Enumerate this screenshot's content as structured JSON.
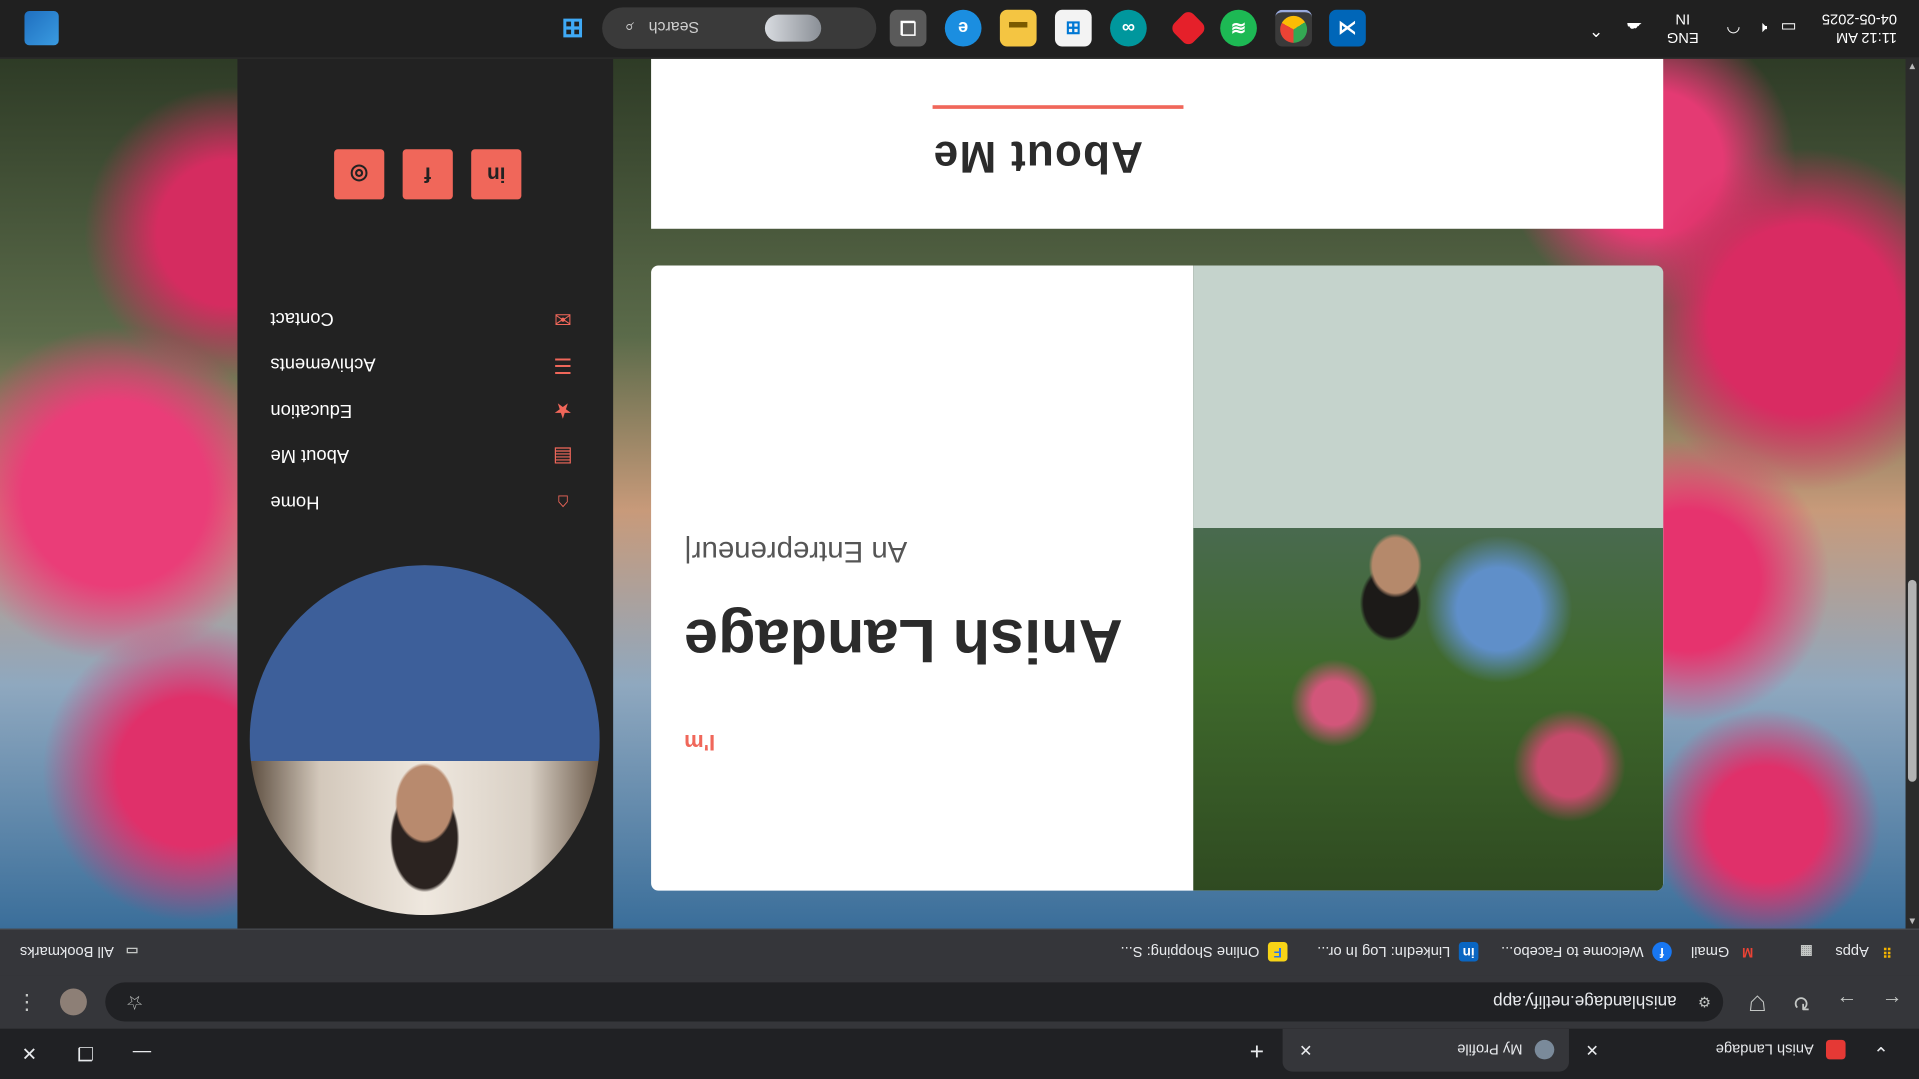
{
  "browser": {
    "tabs": [
      {
        "title": "My Profile",
        "active": true
      },
      {
        "title": "Anish Landage",
        "active": false
      }
    ],
    "new_tab": "+",
    "url": "anishlandage.netlify.app",
    "bookmarks": [
      {
        "label": "Apps",
        "icon": "apps-grid-icon"
      },
      {
        "label": "Gmail",
        "icon": "gmail-icon"
      },
      {
        "label": "Welcome to Facebo...",
        "icon": "facebook-icon"
      },
      {
        "label": "LinkedIn: Log In or...",
        "icon": "linkedin-icon"
      },
      {
        "label": "Online Shopping: S...",
        "icon": "flipkart-icon"
      }
    ],
    "all_bookmarks": "All Bookmarks"
  },
  "sidebar": {
    "nav": [
      {
        "label": "Home",
        "icon": "home-icon"
      },
      {
        "label": "About Me",
        "icon": "id-card-icon"
      },
      {
        "label": "Education",
        "icon": "graduation-icon"
      },
      {
        "label": "Achivements",
        "icon": "list-icon"
      },
      {
        "label": "Contact",
        "icon": "envelope-icon"
      }
    ],
    "socials": [
      {
        "label": "in",
        "icon": "linkedin-icon"
      },
      {
        "label": "f",
        "icon": "facebook-icon"
      },
      {
        "label": "◎",
        "icon": "instagram-icon"
      }
    ]
  },
  "hero": {
    "greeting": "I'm",
    "name": "Anish Landage",
    "role": "An Entrepreneur|"
  },
  "about": {
    "title": "About Me"
  },
  "taskbar": {
    "search_placeholder": "Search",
    "time": "11:12 AM",
    "date": "04-05-2025",
    "lang_top": "ENG",
    "lang_bottom": "IN"
  },
  "colors": {
    "accent": "#f0675a",
    "sidebar_bg": "#222222",
    "card_bg": "#ffffff",
    "taskbar_bg": "#202020"
  }
}
